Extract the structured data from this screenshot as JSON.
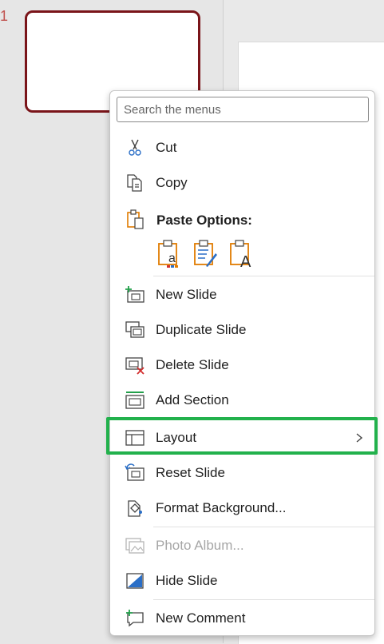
{
  "thumbnail": {
    "slide_number": "1"
  },
  "search": {
    "placeholder": "Search the menus"
  },
  "menu": {
    "cut": "Cut",
    "copy": "Copy",
    "paste_options": "Paste Options:",
    "new_slide": "New Slide",
    "duplicate_slide": "Duplicate Slide",
    "delete_slide": "Delete Slide",
    "add_section": "Add Section",
    "layout": "Layout",
    "reset_slide": "Reset Slide",
    "format_background": "Format Background...",
    "photo_album": "Photo Album...",
    "hide_slide": "Hide Slide",
    "new_comment": "New Comment"
  },
  "paste_buttons": [
    {
      "icon": "paste-use-destination-theme-icon",
      "glyph": "a"
    },
    {
      "icon": "paste-keep-source-formatting-icon",
      "glyph": ""
    },
    {
      "icon": "paste-keep-text-only-icon",
      "glyph": "A"
    }
  ],
  "colors": {
    "highlight": "#22b14c",
    "thumb_border": "#7a1419",
    "clipboard": "#e07b00",
    "delete_x": "#d32f2f"
  },
  "state": {
    "photo_album_disabled": true,
    "highlighted_item": "Layout"
  }
}
